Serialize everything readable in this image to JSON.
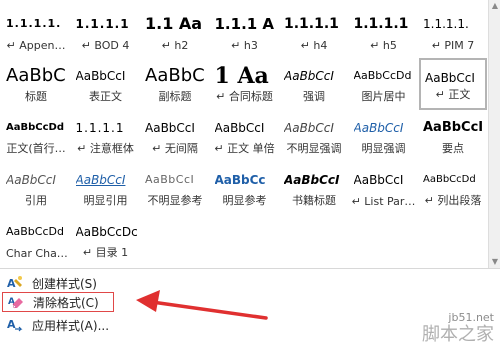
{
  "gallery": {
    "rows": [
      [
        {
          "preview": "1.1.1.1.",
          "label": "↵ Appen…",
          "pstyle": "r0a"
        },
        {
          "preview": "1.1.1.1",
          "label": "↵ BOD 4",
          "pstyle": "r0b"
        },
        {
          "preview": "1.1 Aa",
          "label": "↵ h2",
          "pstyle": "r0c"
        },
        {
          "preview": "1.1.1 A",
          "label": "↵ h3",
          "pstyle": "r0d"
        },
        {
          "preview": "1.1.1.1",
          "label": "↵ h4",
          "pstyle": "r0e"
        },
        {
          "preview": "1.1.1.1",
          "label": "↵ h5",
          "pstyle": "r0f"
        },
        {
          "preview": "1.1.1.1.",
          "label": "↵ PIM 7",
          "pstyle": "r0g"
        }
      ],
      [
        {
          "preview": "AaBbC",
          "label": "标题",
          "pstyle": "r1a"
        },
        {
          "preview": "AaBbCcI",
          "label": "表正文",
          "pstyle": "r1b"
        },
        {
          "preview": "AaBbC",
          "label": "副标题",
          "pstyle": "r1c"
        },
        {
          "preview": "1 Aa",
          "label": "↵ 合同标题",
          "pstyle": "r1d"
        },
        {
          "preview": "AaBbCcI",
          "label": "强调",
          "pstyle": "r1e"
        },
        {
          "preview": "AaBbCcDd",
          "label": "图片居中",
          "pstyle": "r1f"
        },
        {
          "preview": "AaBbCcI",
          "label": "↵ 正文",
          "pstyle": "r1g",
          "selected": true
        }
      ],
      [
        {
          "preview": "AaBbCcDd",
          "label": "正文(首行…",
          "pstyle": "r2a"
        },
        {
          "preview": "1.1.1.1",
          "label": "↵ 注意框体",
          "pstyle": "r2b"
        },
        {
          "preview": "AaBbCcI",
          "label": "↵ 无间隔",
          "pstyle": "r2c"
        },
        {
          "preview": "AaBbCcI",
          "label": "↵ 正文 单倍",
          "pstyle": "r2d"
        },
        {
          "preview": "AaBbCcI",
          "label": "不明显强调",
          "pstyle": "r2e"
        },
        {
          "preview": "AaBbCcI",
          "label": "明显强调",
          "pstyle": "r2f"
        },
        {
          "preview": "AaBbCcI",
          "label": "要点",
          "pstyle": "r2g"
        }
      ],
      [
        {
          "preview": "AaBbCcI",
          "label": "引用",
          "pstyle": "r3a"
        },
        {
          "preview": "AaBbCcI",
          "label": "明显引用",
          "pstyle": "r3b"
        },
        {
          "preview": "AaBbCcI",
          "label": "不明显参考",
          "pstyle": "r3c"
        },
        {
          "preview": "AaBbCc",
          "label": "明显参考",
          "pstyle": "r3d"
        },
        {
          "preview": "AaBbCcI",
          "label": "书籍标题",
          "pstyle": "r3e"
        },
        {
          "preview": "AaBbCcI",
          "label": "↵ List Par…",
          "pstyle": "r3f"
        },
        {
          "preview": "AaBbCcDd",
          "label": "↵ 列出段落",
          "pstyle": "r3g"
        }
      ],
      [
        {
          "preview": "AaBbCcDd",
          "label": "Char Cha…",
          "pstyle": "r4a"
        },
        {
          "preview": "AaBbCcDc",
          "label": "↵ 目录 1",
          "pstyle": "r4b"
        }
      ]
    ]
  },
  "menu": {
    "create_style": "创建样式(S)",
    "clear_format": "清除格式(C)",
    "apply_style": "应用样式(A)..."
  },
  "watermark": {
    "url": "jb51.net",
    "site": "脚本之家"
  },
  "colors": {
    "highlight_border": "#e04848",
    "arrow": "#e03030",
    "selected_border": "#b4b4b4",
    "blue_text": "#1f5fa8"
  }
}
